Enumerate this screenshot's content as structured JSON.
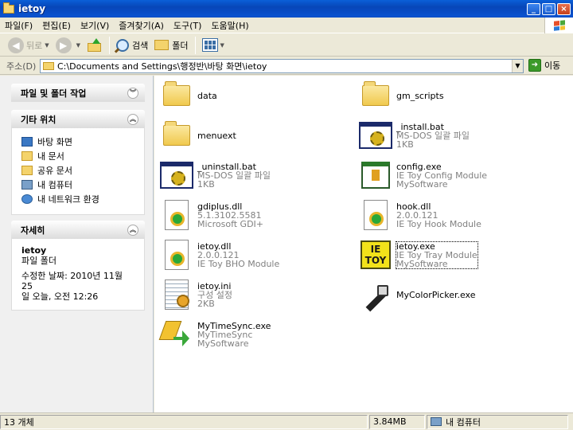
{
  "window": {
    "title": "ietoy",
    "buttons": {
      "minimize": "_",
      "maximize": "□",
      "close": "×"
    }
  },
  "menubar": {
    "items": [
      "파일(F)",
      "편집(E)",
      "보기(V)",
      "즐겨찾기(A)",
      "도구(T)",
      "도움말(H)"
    ]
  },
  "toolbar": {
    "back": "뒤로",
    "search": "검색",
    "folders": "폴더"
  },
  "address": {
    "label": "주소(D)",
    "value": "C:\\Documents and Settings\\행정반\\바탕 화면\\ietoy",
    "go": "이동"
  },
  "left_pane": {
    "tasks": {
      "title": "파일 및 폴더 작업"
    },
    "other_places": {
      "title": "기타 위치",
      "links": [
        {
          "label": "바탕 화면",
          "icon": "desktop-icon"
        },
        {
          "label": "내 문서",
          "icon": "my-documents-icon"
        },
        {
          "label": "공유 문서",
          "icon": "shared-documents-icon"
        },
        {
          "label": "내 컴퓨터",
          "icon": "my-computer-icon"
        },
        {
          "label": "내 네트워크 환경",
          "icon": "network-icon"
        }
      ]
    },
    "details": {
      "title": "자세히",
      "name": "ietoy",
      "type": "파일 폴더",
      "modified_line1": "수정한 날짜: 2010년 11월 25",
      "modified_line2": "일 오늘, 오전 12:26"
    }
  },
  "files": [
    {
      "name": "data",
      "line2": "",
      "line3": "",
      "icon": "folder-icon"
    },
    {
      "name": "gm_scripts",
      "line2": "",
      "line3": "",
      "icon": "folder-icon"
    },
    {
      "name": "menuext",
      "line2": "",
      "line3": "",
      "icon": "folder-icon"
    },
    {
      "name": "_install.bat",
      "line2": "MS-DOS 일괄 파일",
      "line3": "1KB",
      "icon": "batch-file-icon"
    },
    {
      "name": "_uninstall.bat",
      "line2": "MS-DOS 일괄 파일",
      "line3": "1KB",
      "icon": "batch-file-icon"
    },
    {
      "name": "config.exe",
      "line2": "IE Toy Config Module",
      "line3": "MySoftware",
      "icon": "config-exe-icon"
    },
    {
      "name": "gdiplus.dll",
      "line2": "5.1.3102.5581",
      "line3": "Microsoft GDI+",
      "icon": "dll-file-icon"
    },
    {
      "name": "hook.dll",
      "line2": "2.0.0.121",
      "line3": "IE Toy Hook Module",
      "icon": "dll-file-icon"
    },
    {
      "name": "ietoy.dll",
      "line2": "2.0.0.121",
      "line3": "IE Toy BHO Module",
      "icon": "dll-file-icon"
    },
    {
      "name": "ietoy.exe",
      "line2": "IE Toy Tray Module",
      "line3": "MySoftware",
      "icon": "ietoy-exe-icon",
      "selected": true
    },
    {
      "name": "ietoy.ini",
      "line2": "구성 설정",
      "line3": "2KB",
      "icon": "ini-file-icon"
    },
    {
      "name": "MyColorPicker.exe",
      "line2": "",
      "line3": "",
      "icon": "color-picker-icon"
    },
    {
      "name": "MyTimeSync.exe",
      "line2": "MyTimeSync",
      "line3": "MySoftware",
      "icon": "time-sync-icon"
    }
  ],
  "ietoy_icon_text": {
    "line1": "IE",
    "line2": "TOY"
  },
  "statusbar": {
    "count": "13 개체",
    "size": "3.84MB",
    "location": "내 컴퓨터"
  },
  "colors": {
    "titlebar": "#0a5fd8",
    "xp_beige": "#ece9d8",
    "subtext_gray": "#808080"
  }
}
